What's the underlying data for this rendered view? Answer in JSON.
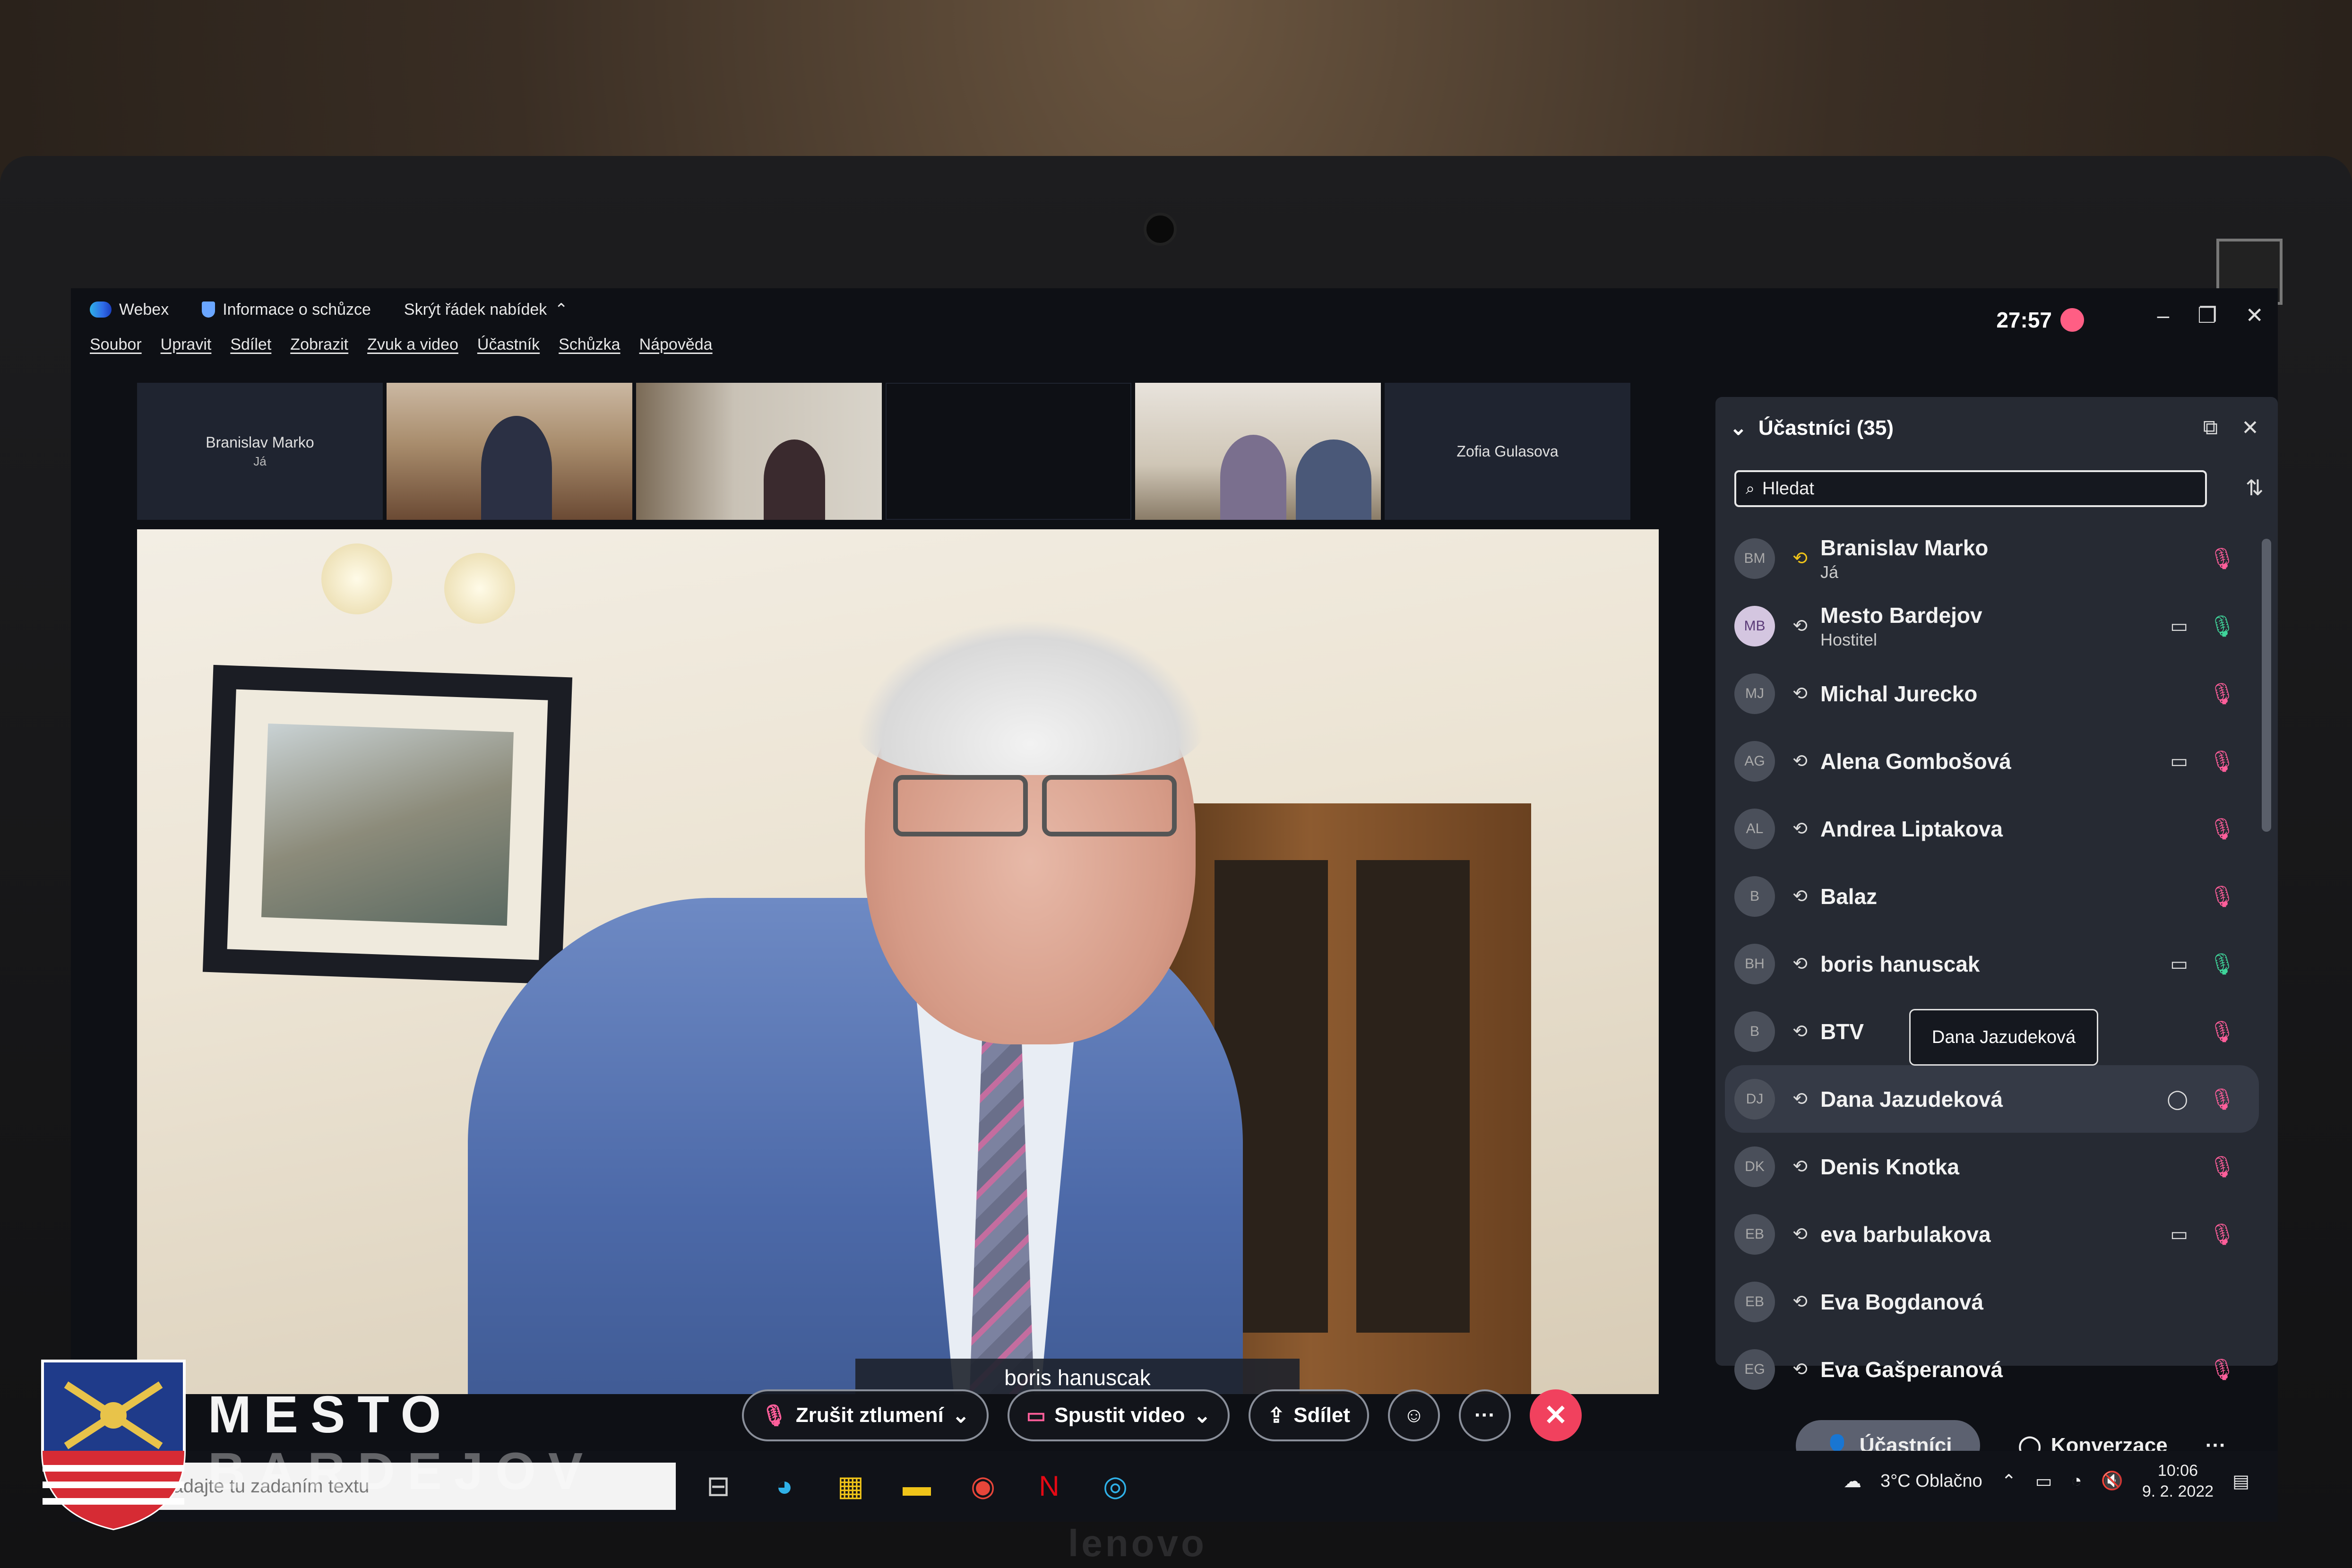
{
  "titlebar": {
    "app": "Webex",
    "meeting_info": "Informace o schůzce",
    "hide_menu": "Skrýt řádek nabídek",
    "timer": "27:57"
  },
  "menu": [
    "Soubor",
    "Upravit",
    "Sdílet",
    "Zobrazit",
    "Zvuk a video",
    "Účastník",
    "Schůzka",
    "Nápověda"
  ],
  "thumbnails": [
    {
      "name": "Branislav Marko",
      "sub": "Já"
    },
    {
      "name": "",
      "sub": ""
    },
    {
      "name": "",
      "sub": ""
    },
    {
      "name": "",
      "sub": ""
    },
    {
      "name": "",
      "sub": ""
    },
    {
      "name": "Zofia Gulasova",
      "sub": ""
    }
  ],
  "active_speaker": "boris hanuscak",
  "panel": {
    "title": "Účastníci (35)",
    "search_placeholder": "Hledat",
    "participants": [
      {
        "initials": "BM",
        "name": "Branislav Marko",
        "role": "Já",
        "camera": false,
        "mic": "muted"
      },
      {
        "initials": "MB",
        "name": "Mesto Bardejov",
        "role": "Hostitel",
        "camera": true,
        "mic": "on"
      },
      {
        "initials": "MJ",
        "name": "Michal Jurecko",
        "role": "",
        "camera": false,
        "mic": "muted"
      },
      {
        "initials": "AG",
        "name": "Alena Gombošová",
        "role": "",
        "camera": true,
        "mic": "muted"
      },
      {
        "initials": "AL",
        "name": "Andrea Liptakova",
        "role": "",
        "camera": false,
        "mic": "muted"
      },
      {
        "initials": "B",
        "name": "Balaz",
        "role": "",
        "camera": false,
        "mic": "muted"
      },
      {
        "initials": "BH",
        "name": "boris hanuscak",
        "role": "",
        "camera": true,
        "mic": "on"
      },
      {
        "initials": "B",
        "name": "BTV",
        "role": "",
        "camera": false,
        "mic": "muted"
      },
      {
        "initials": "DJ",
        "name": "Dana Jazudeková",
        "role": "",
        "camera": false,
        "mic": "muted"
      },
      {
        "initials": "DK",
        "name": "Denis Knotka",
        "role": "",
        "camera": false,
        "mic": "muted"
      },
      {
        "initials": "EB",
        "name": "eva barbulakova",
        "role": "",
        "camera": true,
        "mic": "muted"
      },
      {
        "initials": "EB",
        "name": "Eva Bogdanová",
        "role": "",
        "camera": false,
        "mic": "none"
      },
      {
        "initials": "EG",
        "name": "Eva Gašperanová",
        "role": "",
        "camera": false,
        "mic": "muted"
      }
    ],
    "tooltip": "Dana Jazudeková"
  },
  "controls": {
    "unmute": "Zrušit ztlumení",
    "start_video": "Spustit video",
    "share": "Sdílet"
  },
  "right_tabs": {
    "participants": "Účastníci",
    "chat": "Konverzace"
  },
  "taskbar": {
    "search_placeholder": "Vyhľadajte tu zadaním textu",
    "weather": "3°C Oblačno",
    "time": "10:06",
    "date": "9. 2. 2022"
  },
  "laptop_brand": "lenovo",
  "watermark": {
    "line1": "MESTO",
    "line2": "BARDEJOV"
  },
  "colors": {
    "accent_end": "#f1415e",
    "muted": "#ff5e9a",
    "mic_on": "#3fd49a"
  }
}
